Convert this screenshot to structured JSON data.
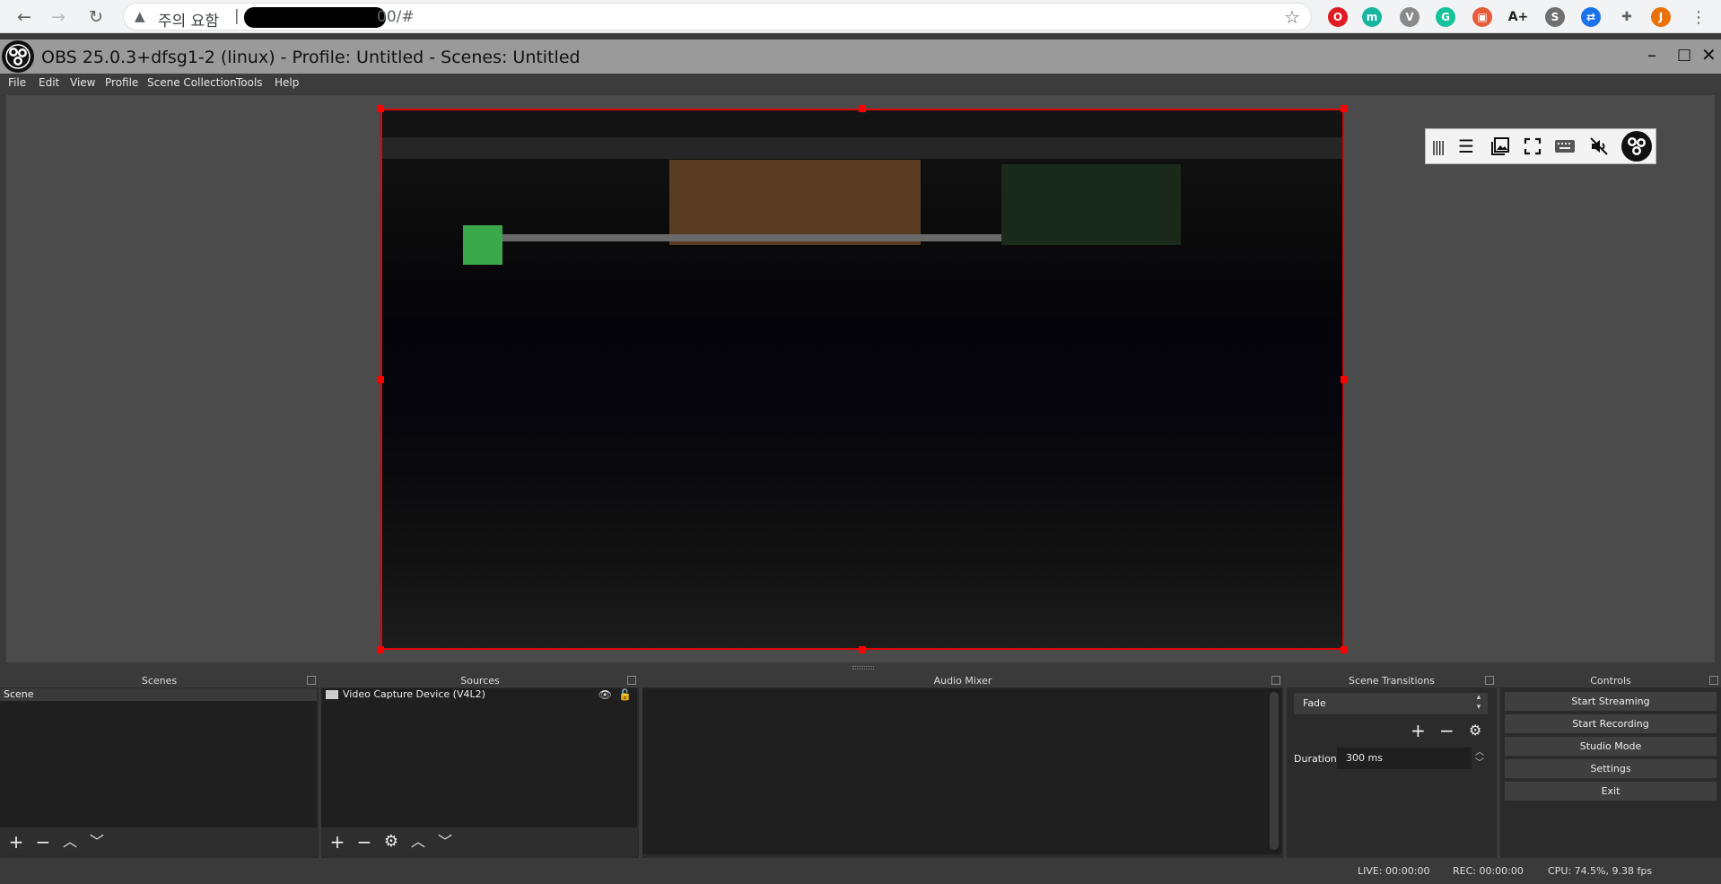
{
  "browser": {
    "back_icon": "arrow-left-icon",
    "forward_icon": "arrow-right-icon",
    "reload_icon": "reload-icon",
    "security_warning": "주의 요함",
    "url_separator": "|",
    "url_visible": "00/#",
    "extensions": [
      {
        "name": "opera-extension",
        "color": "#e01b22",
        "glyph": "O"
      },
      {
        "name": "m-extension",
        "color": "#17b79f",
        "glyph": "m"
      },
      {
        "name": "v-extension",
        "color": "#8a8a8a",
        "glyph": "V"
      },
      {
        "name": "grammarly-extension",
        "color": "#15c39a",
        "glyph": "G"
      },
      {
        "name": "image-extension",
        "color": "#e75b3a",
        "glyph": "▣"
      },
      {
        "name": "font-size-extension",
        "color": "#202124",
        "glyph": "A+"
      },
      {
        "name": "s-extension",
        "color": "#6f6f6f",
        "glyph": "S"
      },
      {
        "name": "translate-extension",
        "color": "#1a73e8",
        "glyph": "⇄"
      },
      {
        "name": "puzzle-extension",
        "color": "#5f6368",
        "glyph": "✚"
      },
      {
        "name": "profile-avatar",
        "color": "#e8710a",
        "glyph": "J"
      }
    ]
  },
  "obs": {
    "title": "OBS 25.0.3+dfsg1-2 (linux) - Profile: Untitled - Scenes: Untitled",
    "menu": [
      "File",
      "Edit",
      "View",
      "Profile",
      "Scene Collection",
      "Tools",
      "Help"
    ],
    "docks": {
      "scenes": {
        "title": "Scenes",
        "items": [
          "Scene"
        ]
      },
      "sources": {
        "title": "Sources",
        "items": [
          "Video Capture Device (V4L2)"
        ]
      },
      "audio_mixer": {
        "title": "Audio Mixer"
      },
      "transitions": {
        "title": "Scene Transitions",
        "selected": "Fade",
        "duration_label": "Duration",
        "duration_value": "300 ms"
      },
      "controls": {
        "title": "Controls",
        "buttons": [
          "Start Streaming",
          "Start Recording",
          "Studio Mode",
          "Settings",
          "Exit"
        ]
      }
    },
    "status": {
      "live": "LIVE: 00:00:00",
      "rec": "REC: 00:00:00",
      "cpu": "CPU: 74.5%, 9.38 fps"
    }
  }
}
